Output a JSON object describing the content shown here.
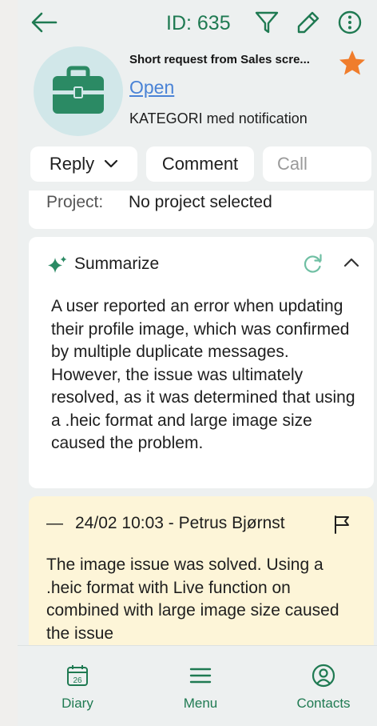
{
  "header": {
    "ticket_id": "ID: 635",
    "title": "Short request from Sales scre...",
    "status": "Open",
    "category": "KATEGORI med notification"
  },
  "actions": {
    "reply": "Reply",
    "comment": "Comment",
    "call": "Call"
  },
  "project": {
    "label": "Project:",
    "value": "No project selected"
  },
  "summary": {
    "title": "Summarize",
    "text": "A user reported an error when updating their profile image, which was confirmed by multiple duplicate messages. However, the issue was ultimately resolved, as it was determined that using a .heic format and large image size caused the problem."
  },
  "message": {
    "header": "24/02 10:03 - Petrus Bjørnst",
    "body": "The image issue was solved. Using a .heic format with Live function on combined with large image size caused the issue"
  },
  "nav": {
    "diary": "Diary",
    "diary_day": "26",
    "menu": "Menu",
    "contacts": "Contacts"
  },
  "colors": {
    "accent": "#1f7a52",
    "link": "#4a83d6",
    "star": "#f07d2c",
    "message_bg": "#fdf5d8",
    "app_bg": "#edf0f0"
  },
  "icons": [
    "back-arrow-icon",
    "filter-icon",
    "edit-pencil-icon",
    "more-options-icon",
    "briefcase-icon",
    "star-icon",
    "chevron-down-icon",
    "sparkle-icon",
    "refresh-icon",
    "collapse-chevron-icon",
    "flag-icon",
    "calendar-icon",
    "hamburger-menu-icon",
    "contacts-icon"
  ]
}
